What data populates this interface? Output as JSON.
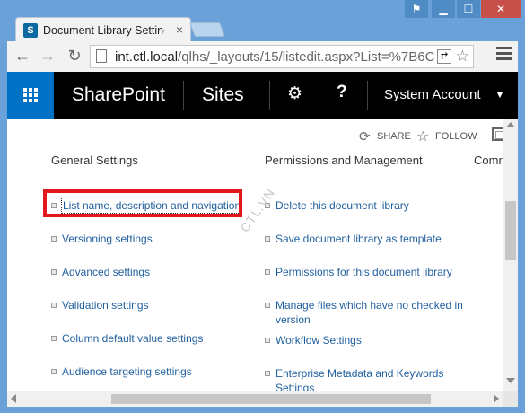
{
  "browser": {
    "tab_title": "Document Library Settings",
    "tab_close": "×",
    "favicon_letter": "S",
    "url_host": "int.ctl.local",
    "url_path": "/qlhs/_layouts/15/listedit.aspx?List=%7B6C",
    "window_buttons": {
      "user": "⚑",
      "minimize": "▁",
      "maximize": "☐",
      "close": "✕"
    }
  },
  "suitebar": {
    "brand": "SharePoint",
    "sites": "Sites",
    "account": "System Account",
    "accent_color": "#0072c6"
  },
  "actions": {
    "share": "SHARE",
    "follow": "FOLLOW"
  },
  "columns": {
    "general": {
      "heading": "General Settings",
      "items": [
        "List name, description and navigation",
        "Versioning settings",
        "Advanced settings",
        "Validation settings",
        "Column default value settings",
        "Audience targeting settings"
      ]
    },
    "permissions": {
      "heading": "Permissions and Management",
      "items": [
        "Delete this document library",
        "Save document library as template",
        "Permissions for this document library",
        "Manage files which have no checked in version",
        "Workflow Settings",
        "Enterprise Metadata and Keywords Settings"
      ]
    },
    "third": {
      "heading": "Comr"
    }
  },
  "watermark": "CTL.VN",
  "highlight_color": "#e3171e",
  "link_color": "#1f5f9e"
}
